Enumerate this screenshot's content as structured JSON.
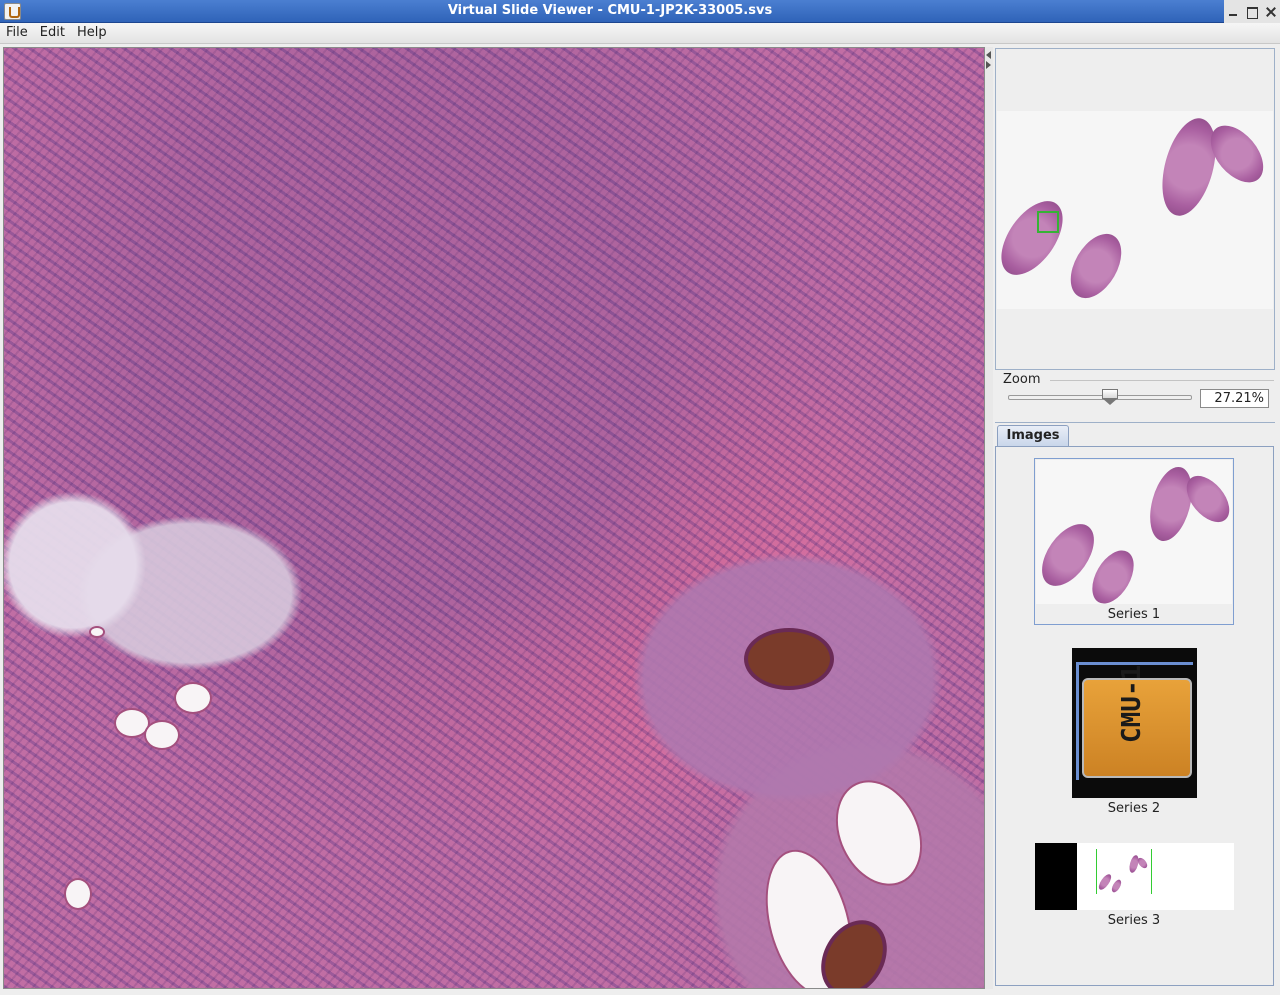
{
  "window": {
    "title": "Virtual Slide Viewer - CMU-1-JP2K-33005.svs"
  },
  "menubar": {
    "items": [
      "File",
      "Edit",
      "Help"
    ]
  },
  "zoom": {
    "label": "Zoom",
    "value_text": "27.21%",
    "slider_fraction": 0.56
  },
  "images_panel": {
    "tab_label": "Images",
    "series": [
      {
        "label": "Series 1",
        "selected": true
      },
      {
        "label": "Series 2",
        "selected": false
      },
      {
        "label": "Series 3",
        "selected": false
      }
    ],
    "slide_label_text": "CMU-1"
  },
  "icons": [
    "app-icon",
    "minimize-icon",
    "maximize-icon",
    "close-icon",
    "collapse-left-arrow-icon",
    "expand-right-arrow-icon"
  ]
}
